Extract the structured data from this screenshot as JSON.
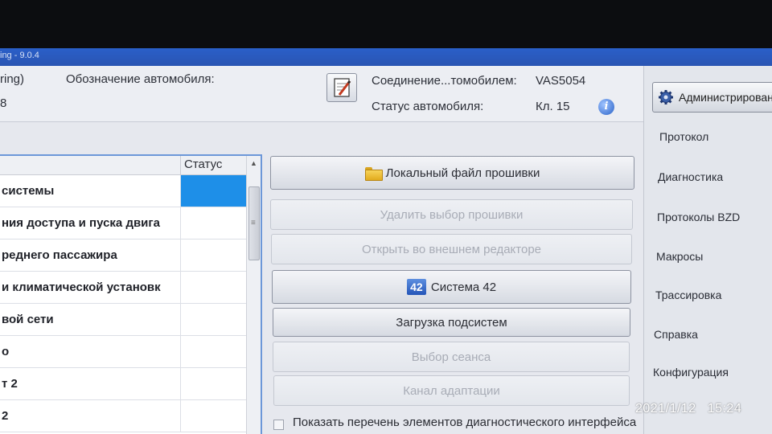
{
  "window": {
    "title_fragment": "ing - 9.0.4"
  },
  "header": {
    "left_fragment": "ring)",
    "left_value_fragment": "8",
    "vehicle_label": "Обозначение автомобиля:",
    "connection_label": "Соединение...томобилем:",
    "connection_value": "VAS5054",
    "status_label": "Статус автомобиля:",
    "status_value": "Кл. 15",
    "edit_icon": "edit-notepad-icon",
    "info_icon": "info-icon"
  },
  "table": {
    "columns": [
      "",
      "Статус"
    ],
    "rows": [
      {
        "name": "системы",
        "status": "",
        "selected": true
      },
      {
        "name": "ния доступа и пуска двига",
        "status": ""
      },
      {
        "name": "реднего пассажира",
        "status": ""
      },
      {
        "name": "и климатической установк",
        "status": ""
      },
      {
        "name": "вой сети",
        "status": ""
      },
      {
        "name": "о",
        "status": ""
      },
      {
        "name": "т 2",
        "status": ""
      },
      {
        "name": "2",
        "status": ""
      }
    ]
  },
  "actions": {
    "local_file": "Локальный файл прошивки",
    "delete_selection": "Удалить выбор прошивки",
    "open_external": "Открыть во внешнем редакторе",
    "system42": "Система 42",
    "system42_icon_text": "42",
    "load_subsystems": "Загрузка подсистем",
    "session_select": "Выбор сеанса",
    "adaptation_channel": "Канал адаптации",
    "show_list_checkbox": "Показать перечень элементов диагностического интерфейса"
  },
  "sidebar": {
    "admin_button": "Администрирован",
    "items": [
      "Протокол",
      "Диагностика",
      "Протоколы BZD",
      "Макросы",
      "Трассировка",
      "Справка",
      "Конфигурация"
    ]
  },
  "photo_stamp": {
    "date": "2021/1/12",
    "time": "15:24"
  },
  "colors": {
    "accent": "#2a5fc9",
    "selection": "#1e8fe8",
    "table_border": "#6c97d8"
  }
}
